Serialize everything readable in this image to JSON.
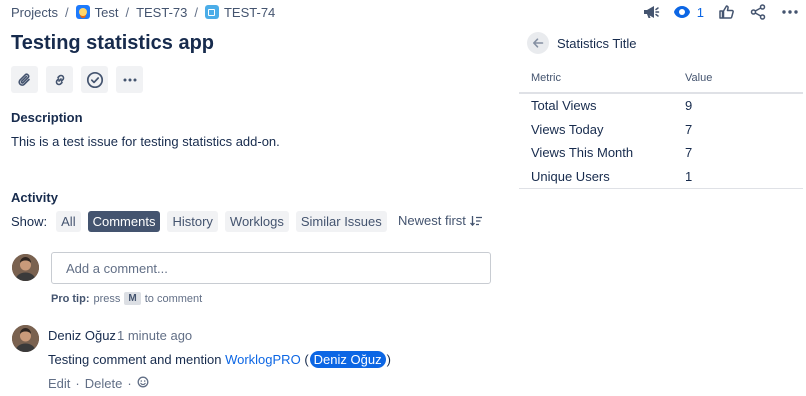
{
  "breadcrumb": {
    "projects": "Projects",
    "project": "Test",
    "parent": "TEST-73",
    "issue": "TEST-74",
    "separator": "/"
  },
  "header_actions": {
    "watch_count": "1",
    "icons": [
      "megaphone-icon",
      "eye-icon",
      "thumbs-up-icon",
      "share-icon",
      "more-icon"
    ]
  },
  "issue": {
    "title": "Testing statistics app",
    "toolbar_icons": [
      "attachment-icon",
      "link-icon",
      "check-circle-icon",
      "more-icon"
    ]
  },
  "description": {
    "heading": "Description",
    "text": "This is a test issue for testing statistics add-on."
  },
  "activity": {
    "heading": "Activity",
    "show_label": "Show:",
    "filters": [
      {
        "label": "All",
        "active": false
      },
      {
        "label": "Comments",
        "active": true
      },
      {
        "label": "History",
        "active": false
      },
      {
        "label": "Worklogs",
        "active": false
      },
      {
        "label": "Similar Issues",
        "active": false
      }
    ],
    "sort_label": "Newest first",
    "comment_placeholder": "Add a comment...",
    "pro_tip_label": "Pro tip:",
    "pro_tip_press": "press",
    "pro_tip_key": "M",
    "pro_tip_suffix": "to comment"
  },
  "comment": {
    "author": "Deniz Oğuz",
    "time": "1 minute ago",
    "text_prefix": "Testing comment and mention",
    "link_text": "WorklogPRO",
    "paren_open": "(",
    "mention": "Deniz Oğuz",
    "paren_close": ")",
    "edit": "Edit",
    "delete": "Delete",
    "dot": "·"
  },
  "stats_panel": {
    "title": "Statistics Title",
    "columns": [
      "Metric",
      "Value"
    ],
    "rows": [
      {
        "metric": "Total Views",
        "value": "9"
      },
      {
        "metric": "Views Today",
        "value": "7"
      },
      {
        "metric": "Views This Month",
        "value": "7"
      },
      {
        "metric": "Unique Users",
        "value": "1"
      }
    ]
  },
  "colors": {
    "link": "#0c66e4",
    "active_filter": "#44546f",
    "text": "#172b4d"
  }
}
